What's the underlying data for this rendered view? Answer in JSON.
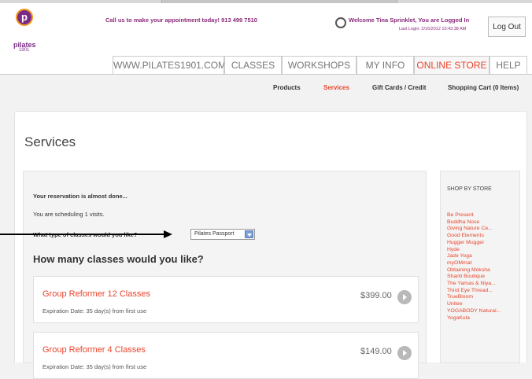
{
  "header": {
    "logo_letter": "p",
    "logo_word": "pilates",
    "logo_year": "1901",
    "promo": "Call us to make your appointment today! 913 499 7510",
    "welcome": "Welcome Tina Sprinklet, You are Logged In",
    "last_login": "Last Login: 2/16/2012 10:43:38 AM",
    "logout_label": "Log Out"
  },
  "nav": {
    "tabs": [
      {
        "label": "WWW.PILATES1901.COM"
      },
      {
        "label": "CLASSES"
      },
      {
        "label": "WORKSHOPS"
      },
      {
        "label": "MY INFO"
      },
      {
        "label": "ONLINE STORE"
      },
      {
        "label": "HELP"
      }
    ],
    "active": "ONLINE STORE"
  },
  "subnav": {
    "links": [
      {
        "label": "Products"
      },
      {
        "label": "Services"
      },
      {
        "label": "Gift Cards / Credit"
      },
      {
        "label": "Shopping Cart (0 Items)"
      }
    ],
    "active": "Services"
  },
  "main": {
    "title": "Services",
    "almost_done": "Your reservation is almost done...",
    "scheduling": "You are scheduling 1 visits.",
    "question": "What type of classes would you like?",
    "class_type_selected": "Pilates Passport",
    "how_many": "How many classes would you like?",
    "offers": [
      {
        "name": "Group Reformer 12 Classes",
        "sub": "Expiration Date: 35 day(s) from first use",
        "price": "$399.00"
      },
      {
        "name": "Group Reformer 4 Classes",
        "sub": "Expiration Date: 35 day(s) from first use",
        "price": "$149.00"
      }
    ]
  },
  "sidebar": {
    "heading": "SHOP BY STORE",
    "stores": [
      "Be Present",
      "Buddha Nose",
      "Giving Nature Ce...",
      "Good Elements",
      "Hugger Mugger",
      "Hyde",
      "Jade Yoga",
      "myOMmat",
      "Obtaining Moksha",
      "Shanti Boutique",
      "The Yamas & Niya...",
      "Third Eye Thread...",
      "TrueBloom",
      "Unitee",
      "YOGABODY Natural...",
      "YogaKula"
    ]
  },
  "colors": {
    "accent": "#e8452c",
    "brand_purple": "#7a2a87",
    "brand_orange": "#f39a1d"
  }
}
